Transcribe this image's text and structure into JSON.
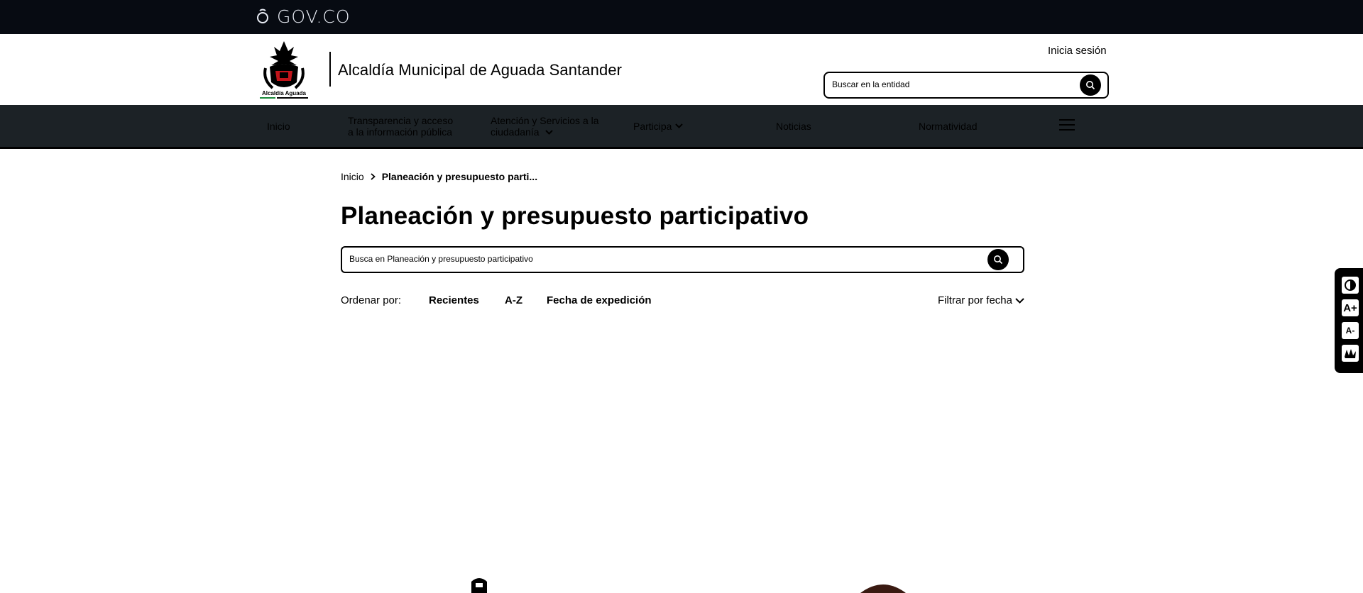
{
  "govbar": {
    "brand": "GOV.CO",
    "icon": "govco-icon"
  },
  "header": {
    "entity_title": "Alcaldía Municipal de Aguada Santander",
    "crest_text": "Alcaldía Aguada",
    "login": "Inicia sesión",
    "search_placeholder": "Buscar en la entidad"
  },
  "nav": {
    "items": [
      {
        "label": "Inicio"
      },
      {
        "label_1": "Transparencia y acceso",
        "label_2": "a la información pública"
      },
      {
        "label_1": "Atención y Servicios a la",
        "label_2": "ciudadanía"
      },
      {
        "label": "Participa"
      },
      {
        "label": "Noticias"
      },
      {
        "label": "Normatividad"
      }
    ],
    "menu_icon": "hamburger-icon"
  },
  "breadcrumb": {
    "home": "Inicio",
    "current": "Planeación y presupuesto parti..."
  },
  "page": {
    "title": "Planeación y presupuesto participativo",
    "search_placeholder": "Busca en Planeación y presupuesto participativo"
  },
  "sort": {
    "label": "Ordenar por:",
    "options": [
      "Recientes",
      "A-Z",
      "Fecha de expedición"
    ],
    "filter": "Filtrar por fecha"
  },
  "a11y": {
    "buttons": [
      "contrast-icon",
      "increase-font-icon",
      "decrease-font-icon",
      "sign-language-icon"
    ],
    "increase_label": "A+",
    "decrease_label": "A-"
  },
  "colors": {
    "topbar": "#070b12",
    "nav": "#1c2226",
    "text": "#000000"
  }
}
